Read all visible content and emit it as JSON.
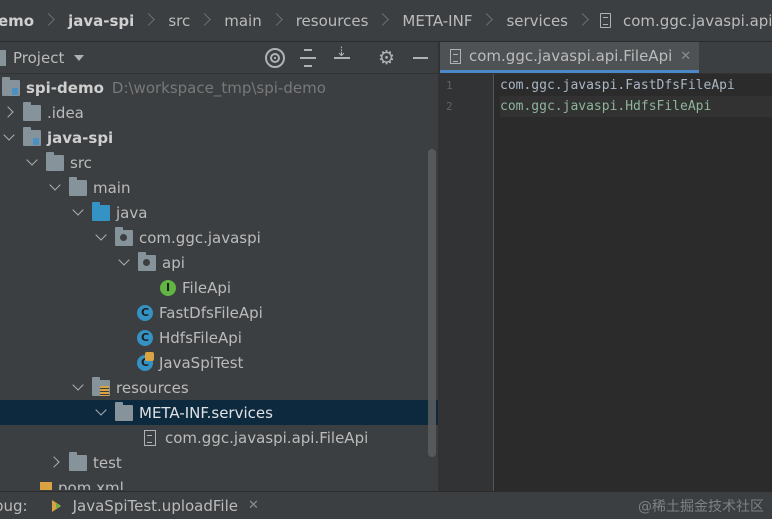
{
  "breadcrumb": {
    "items": [
      {
        "label": "emo",
        "bold": true
      },
      {
        "label": "java-spi",
        "bold": true
      },
      {
        "label": "src"
      },
      {
        "label": "main"
      },
      {
        "label": "resources"
      },
      {
        "label": "META-INF"
      },
      {
        "label": "services"
      },
      {
        "label": "com.ggc.javaspi.api.FileApi"
      }
    ]
  },
  "project_panel": {
    "title": "Project",
    "tree": [
      {
        "label": "spi-demo",
        "hint": "D:\\workspace_tmp\\spi-demo",
        "icon": "module-folder-icon",
        "expanded": true
      },
      {
        "label": ".idea",
        "icon": "folder-icon",
        "expanded": false
      },
      {
        "label": "java-spi",
        "icon": "module-folder-icon",
        "expanded": true
      },
      {
        "label": "src",
        "icon": "folder-icon",
        "expanded": true
      },
      {
        "label": "main",
        "icon": "folder-icon",
        "expanded": true
      },
      {
        "label": "java",
        "icon": "source-folder-icon",
        "expanded": true
      },
      {
        "label": "com.ggc.javaspi",
        "icon": "package-icon",
        "expanded": true
      },
      {
        "label": "api",
        "icon": "package-icon",
        "expanded": true
      },
      {
        "label": "FileApi",
        "icon": "interface-icon",
        "badge": "I"
      },
      {
        "label": "FastDfsFileApi",
        "icon": "class-icon",
        "badge": "C"
      },
      {
        "label": "HdfsFileApi",
        "icon": "class-icon",
        "badge": "C"
      },
      {
        "label": "JavaSpiTest",
        "icon": "test-class-icon",
        "badge": "C"
      },
      {
        "label": "resources",
        "icon": "resources-folder-icon",
        "expanded": true
      },
      {
        "label": "META-INF.services",
        "icon": "folder-icon",
        "expanded": true,
        "selected": true
      },
      {
        "label": "com.ggc.javaspi.api.FileApi",
        "icon": "text-file-icon"
      },
      {
        "label": "test",
        "icon": "folder-icon",
        "expanded": false
      },
      {
        "label": "pom.xml",
        "icon": "maven-icon"
      }
    ]
  },
  "editor": {
    "tab_label": "com.ggc.javaspi.api.FileApi",
    "lines": [
      {
        "number": "1",
        "text": "com.ggc.javaspi.FastDfsFileApi"
      },
      {
        "number": "2",
        "text": "com.ggc.javaspi.HdfsFileApi"
      }
    ]
  },
  "bottom_bar": {
    "label": "bug:",
    "config": "JavaSpiTest.uploadFile"
  },
  "watermark": "@稀土掘金技术社区",
  "colors": {
    "panel_bg": "#3c3f41",
    "editor_bg": "#2b2b2b",
    "selection": "#0d293e",
    "folder_blue": "#3592c4",
    "interface_green": "#62b543",
    "tab_underline": "#4a88c7"
  }
}
